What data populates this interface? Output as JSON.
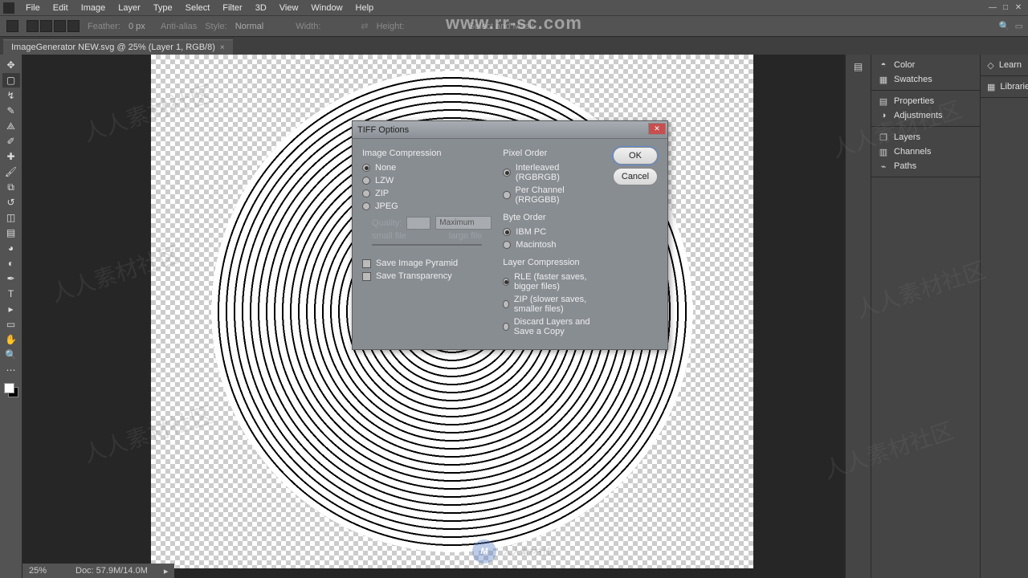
{
  "menu": [
    "File",
    "Edit",
    "Image",
    "Layer",
    "Type",
    "Select",
    "Filter",
    "3D",
    "View",
    "Window",
    "Help"
  ],
  "optbar": {
    "feather": "Feather:",
    "feather_val": "0 px",
    "antialias": "Anti-alias",
    "style": "Style:",
    "style_val": "Normal",
    "width": "Width:",
    "height": "Height:",
    "selectmask": "Select and Mask..."
  },
  "tab": {
    "title": "ImageGenerator NEW.svg @ 25% (Layer 1, RGB/8)"
  },
  "status": {
    "zoom": "25%",
    "doc": "Doc: 57.9M/14.0M"
  },
  "panels": {
    "g1": [
      "Color",
      "Swatches"
    ],
    "g2": [
      "Properties",
      "Adjustments"
    ],
    "g3": [
      "Layers",
      "Channels",
      "Paths"
    ],
    "right": [
      "Learn",
      "Libraries"
    ]
  },
  "dialog": {
    "title": "TIFF Options",
    "ok": "OK",
    "cancel": "Cancel",
    "img_comp": {
      "title": "Image Compression",
      "opts": [
        "None",
        "LZW",
        "ZIP",
        "JPEG"
      ],
      "quality": "Quality:",
      "qsel": "Maximum",
      "small": "small file",
      "large": "large file"
    },
    "save_pyramid": "Save Image Pyramid",
    "save_trans": "Save Transparency",
    "pixel_order": {
      "title": "Pixel Order",
      "opts": [
        "Interleaved (RGBRGB)",
        "Per Channel (RRGGBB)"
      ]
    },
    "byte_order": {
      "title": "Byte Order",
      "opts": [
        "IBM PC",
        "Macintosh"
      ]
    },
    "layer_comp": {
      "title": "Layer Compression",
      "opts": [
        "RLE (faster saves, bigger files)",
        "ZIP (slower saves, smaller files)",
        "Discard Layers and Save a Copy"
      ]
    }
  },
  "watermark": {
    "url": "www.rr-sc.com",
    "cn": "人人素材社区",
    "logo": "M"
  }
}
